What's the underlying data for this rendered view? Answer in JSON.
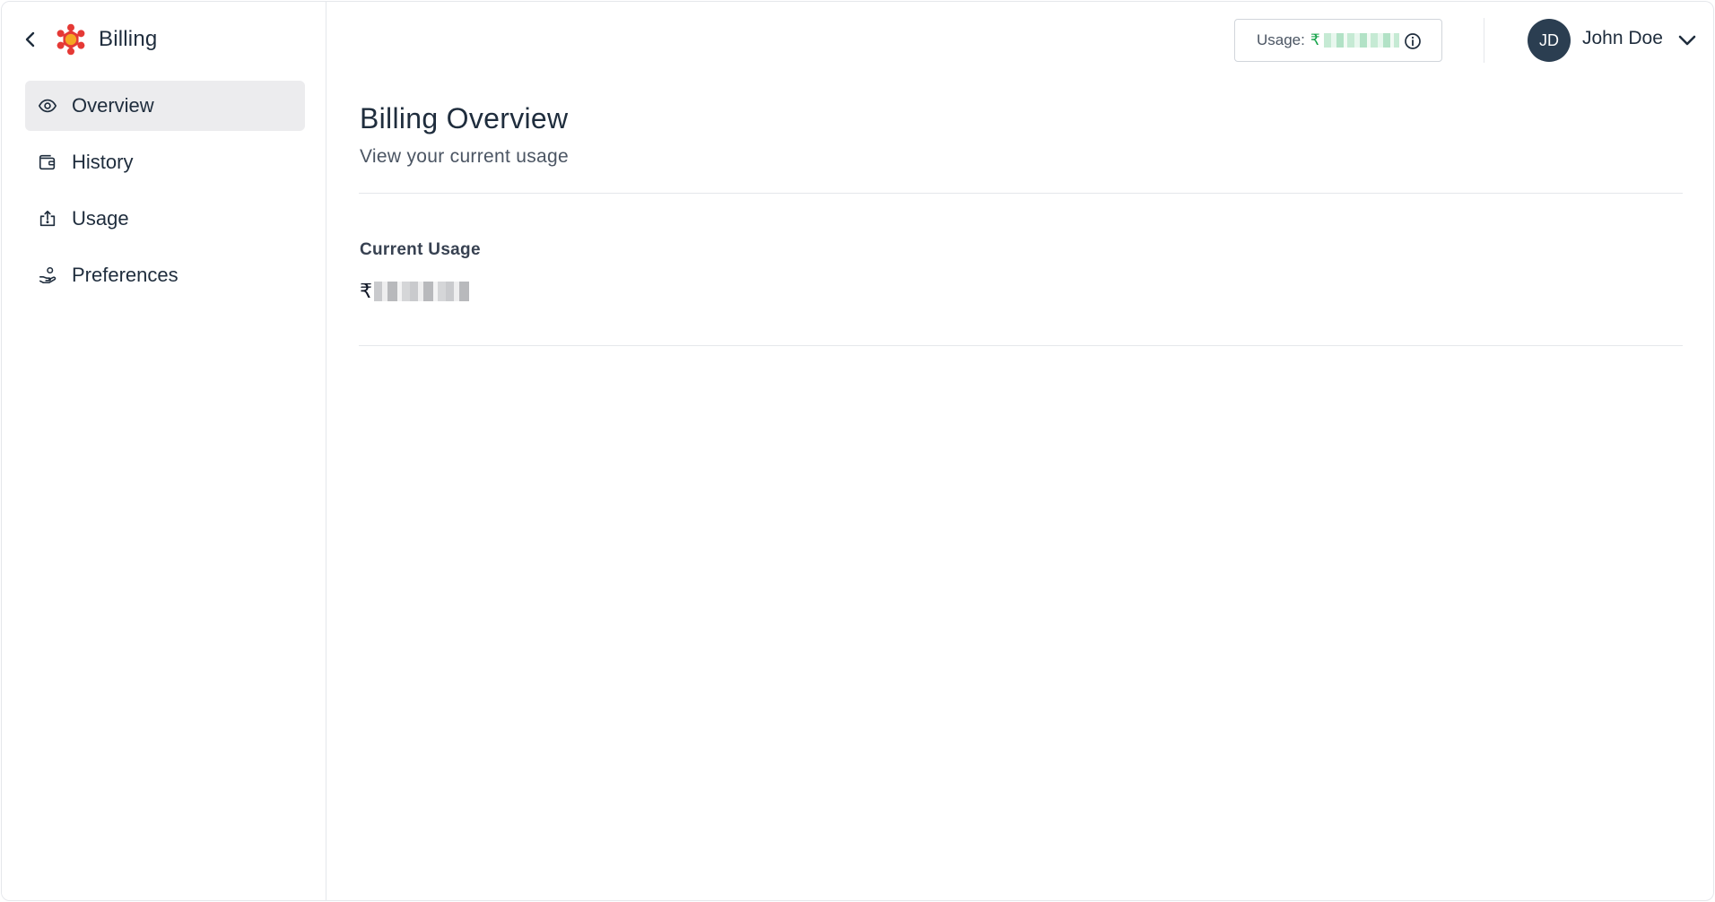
{
  "app": {
    "title": "Billing",
    "brand_color": "#e53935"
  },
  "sidebar": {
    "items": [
      {
        "label": "Overview",
        "icon": "eye-icon",
        "active": true
      },
      {
        "label": "History",
        "icon": "wallet-icon",
        "active": false
      },
      {
        "label": "Usage",
        "icon": "upload-box-icon",
        "active": false
      },
      {
        "label": "Preferences",
        "icon": "hand-coin-icon",
        "active": false
      }
    ]
  },
  "header": {
    "usage_label": "Usage:",
    "usage_currency": "₹",
    "usage_value_color": "#16a34a",
    "user": {
      "initials": "JD",
      "name": "John Doe"
    }
  },
  "main": {
    "title": "Billing Overview",
    "subtitle": "View your current usage",
    "section_label": "Current Usage",
    "currency": "₹"
  }
}
